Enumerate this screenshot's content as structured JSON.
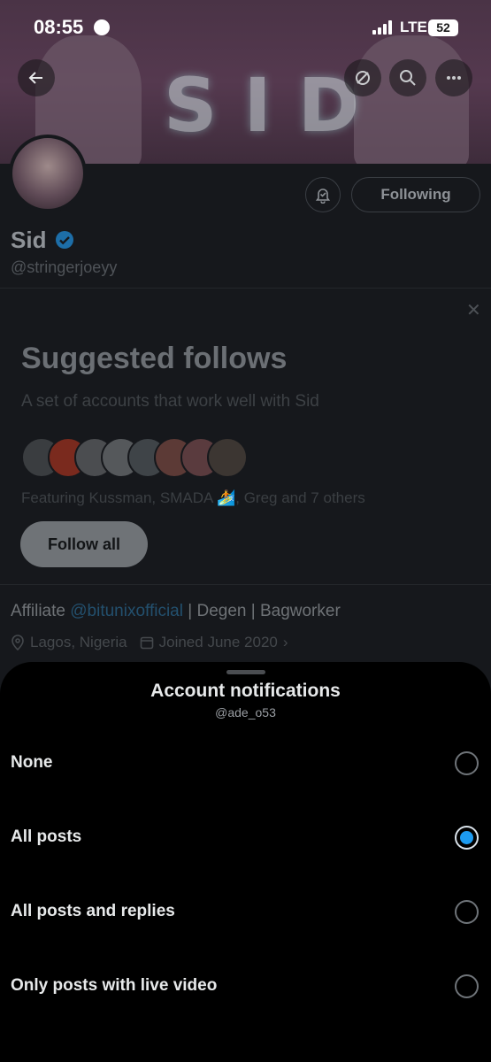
{
  "status_bar": {
    "time": "08:55",
    "network": "LTE",
    "battery": "52"
  },
  "banner": {
    "text": "SID"
  },
  "profile": {
    "name": "Sid",
    "handle": "@stringerjoeyy",
    "following_label": "Following",
    "bio_prefix": "Affiliate ",
    "bio_mention": "@bitunixofficial",
    "bio_suffix": " | Degen | Bagworker",
    "location": "Lagos, Nigeria",
    "joined": "Joined June 2020"
  },
  "suggested": {
    "title": "Suggested follows",
    "subtitle": "A set of accounts that work well with Sid",
    "featuring": "Featuring Kussman, SMADA 🏄, Greg and 7 others",
    "follow_all_label": "Follow all"
  },
  "sheet": {
    "title": "Account notifications",
    "subtitle": "@ade_o53",
    "options": [
      {
        "label": "None",
        "selected": false
      },
      {
        "label": "All posts",
        "selected": true
      },
      {
        "label": "All posts and replies",
        "selected": false
      },
      {
        "label": "Only posts with live video",
        "selected": false
      }
    ]
  },
  "colors": {
    "accent": "#1d9bf0",
    "sheet_bg": "#000000",
    "page_bg": "#16181c"
  },
  "icons": [
    "back-arrow-icon",
    "mute-icon",
    "search-icon",
    "more-icon",
    "bell-icon",
    "verified-badge-icon",
    "close-icon",
    "location-icon",
    "calendar-icon",
    "chevron-right-icon"
  ]
}
